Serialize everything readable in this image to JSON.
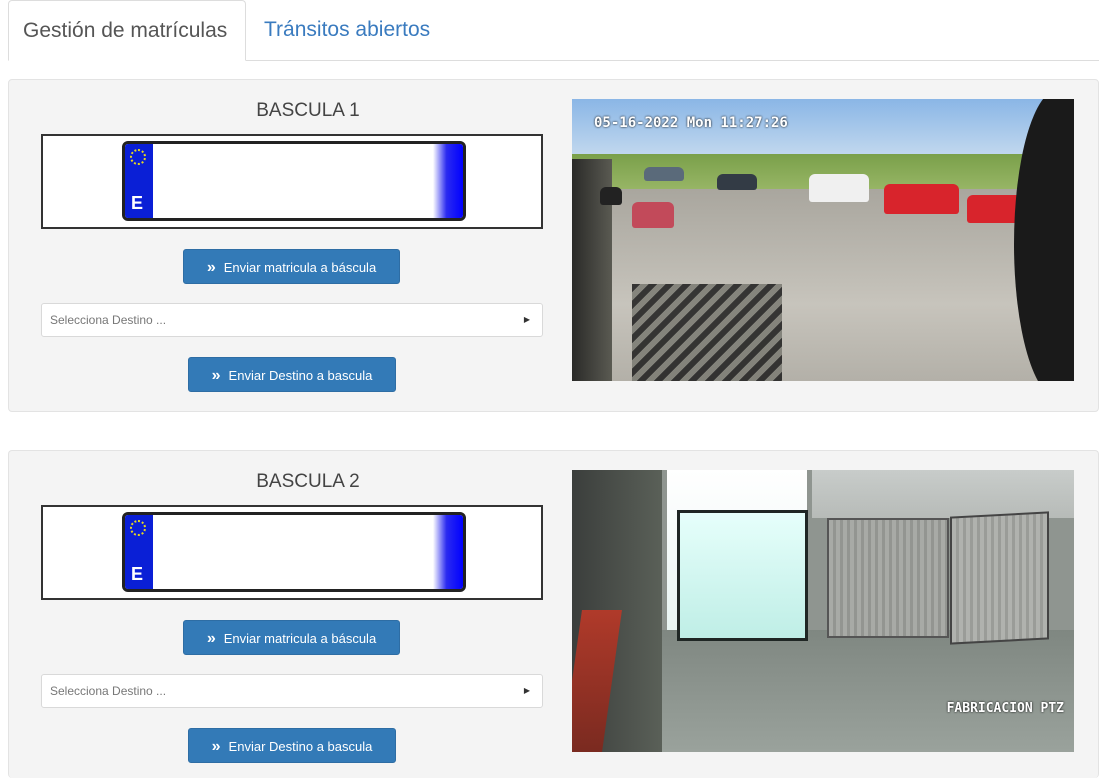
{
  "tabs": [
    {
      "label": "Gestión de matrículas",
      "active": true
    },
    {
      "label": "Tránsitos abiertos",
      "active": false
    }
  ],
  "basculas": [
    {
      "title": "BASCULA 1",
      "plate_country": "E",
      "send_plate_label": "Enviar matricula a báscula",
      "destination_placeholder": "Selecciona Destino ...",
      "send_destination_label": "Enviar Destino a bascula",
      "camera_osd": "05-16-2022 Mon 11:27:26"
    },
    {
      "title": "BASCULA 2",
      "plate_country": "E",
      "send_plate_label": "Enviar matricula a báscula",
      "destination_placeholder": "Selecciona Destino ...",
      "send_destination_label": "Enviar Destino a bascula",
      "camera_osd": "FABRICACION PTZ"
    }
  ],
  "colors": {
    "primary_button": "#337ab7",
    "tab_link": "#3a7bbf",
    "panel_bg": "#f4f4f4",
    "plate_eu_band": "#0a1fd6"
  },
  "icons": {
    "button_icon": "double-chevron-right-icon",
    "select_icon": "caret-right-icon"
  }
}
